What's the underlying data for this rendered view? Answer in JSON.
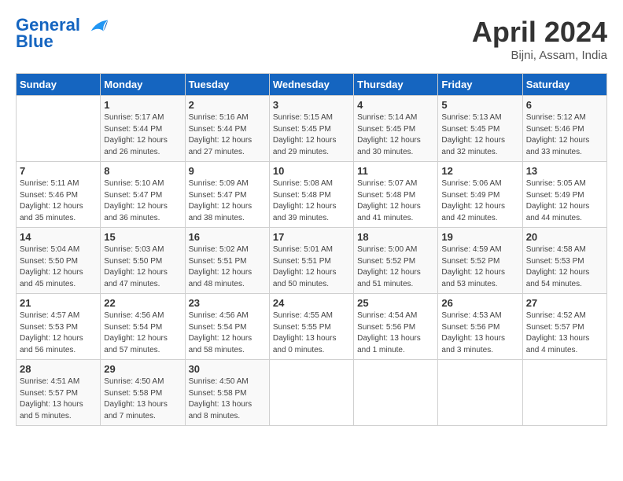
{
  "header": {
    "logo_line1": "General",
    "logo_line2": "Blue",
    "month_title": "April 2024",
    "location": "Bijni, Assam, India"
  },
  "days_header": [
    "Sunday",
    "Monday",
    "Tuesday",
    "Wednesday",
    "Thursday",
    "Friday",
    "Saturday"
  ],
  "weeks": [
    [
      {
        "day": "",
        "info": ""
      },
      {
        "day": "1",
        "info": "Sunrise: 5:17 AM\nSunset: 5:44 PM\nDaylight: 12 hours\nand 26 minutes."
      },
      {
        "day": "2",
        "info": "Sunrise: 5:16 AM\nSunset: 5:44 PM\nDaylight: 12 hours\nand 27 minutes."
      },
      {
        "day": "3",
        "info": "Sunrise: 5:15 AM\nSunset: 5:45 PM\nDaylight: 12 hours\nand 29 minutes."
      },
      {
        "day": "4",
        "info": "Sunrise: 5:14 AM\nSunset: 5:45 PM\nDaylight: 12 hours\nand 30 minutes."
      },
      {
        "day": "5",
        "info": "Sunrise: 5:13 AM\nSunset: 5:45 PM\nDaylight: 12 hours\nand 32 minutes."
      },
      {
        "day": "6",
        "info": "Sunrise: 5:12 AM\nSunset: 5:46 PM\nDaylight: 12 hours\nand 33 minutes."
      }
    ],
    [
      {
        "day": "7",
        "info": "Sunrise: 5:11 AM\nSunset: 5:46 PM\nDaylight: 12 hours\nand 35 minutes."
      },
      {
        "day": "8",
        "info": "Sunrise: 5:10 AM\nSunset: 5:47 PM\nDaylight: 12 hours\nand 36 minutes."
      },
      {
        "day": "9",
        "info": "Sunrise: 5:09 AM\nSunset: 5:47 PM\nDaylight: 12 hours\nand 38 minutes."
      },
      {
        "day": "10",
        "info": "Sunrise: 5:08 AM\nSunset: 5:48 PM\nDaylight: 12 hours\nand 39 minutes."
      },
      {
        "day": "11",
        "info": "Sunrise: 5:07 AM\nSunset: 5:48 PM\nDaylight: 12 hours\nand 41 minutes."
      },
      {
        "day": "12",
        "info": "Sunrise: 5:06 AM\nSunset: 5:49 PM\nDaylight: 12 hours\nand 42 minutes."
      },
      {
        "day": "13",
        "info": "Sunrise: 5:05 AM\nSunset: 5:49 PM\nDaylight: 12 hours\nand 44 minutes."
      }
    ],
    [
      {
        "day": "14",
        "info": "Sunrise: 5:04 AM\nSunset: 5:50 PM\nDaylight: 12 hours\nand 45 minutes."
      },
      {
        "day": "15",
        "info": "Sunrise: 5:03 AM\nSunset: 5:50 PM\nDaylight: 12 hours\nand 47 minutes."
      },
      {
        "day": "16",
        "info": "Sunrise: 5:02 AM\nSunset: 5:51 PM\nDaylight: 12 hours\nand 48 minutes."
      },
      {
        "day": "17",
        "info": "Sunrise: 5:01 AM\nSunset: 5:51 PM\nDaylight: 12 hours\nand 50 minutes."
      },
      {
        "day": "18",
        "info": "Sunrise: 5:00 AM\nSunset: 5:52 PM\nDaylight: 12 hours\nand 51 minutes."
      },
      {
        "day": "19",
        "info": "Sunrise: 4:59 AM\nSunset: 5:52 PM\nDaylight: 12 hours\nand 53 minutes."
      },
      {
        "day": "20",
        "info": "Sunrise: 4:58 AM\nSunset: 5:53 PM\nDaylight: 12 hours\nand 54 minutes."
      }
    ],
    [
      {
        "day": "21",
        "info": "Sunrise: 4:57 AM\nSunset: 5:53 PM\nDaylight: 12 hours\nand 56 minutes."
      },
      {
        "day": "22",
        "info": "Sunrise: 4:56 AM\nSunset: 5:54 PM\nDaylight: 12 hours\nand 57 minutes."
      },
      {
        "day": "23",
        "info": "Sunrise: 4:56 AM\nSunset: 5:54 PM\nDaylight: 12 hours\nand 58 minutes."
      },
      {
        "day": "24",
        "info": "Sunrise: 4:55 AM\nSunset: 5:55 PM\nDaylight: 13 hours\nand 0 minutes."
      },
      {
        "day": "25",
        "info": "Sunrise: 4:54 AM\nSunset: 5:56 PM\nDaylight: 13 hours\nand 1 minute."
      },
      {
        "day": "26",
        "info": "Sunrise: 4:53 AM\nSunset: 5:56 PM\nDaylight: 13 hours\nand 3 minutes."
      },
      {
        "day": "27",
        "info": "Sunrise: 4:52 AM\nSunset: 5:57 PM\nDaylight: 13 hours\nand 4 minutes."
      }
    ],
    [
      {
        "day": "28",
        "info": "Sunrise: 4:51 AM\nSunset: 5:57 PM\nDaylight: 13 hours\nand 5 minutes."
      },
      {
        "day": "29",
        "info": "Sunrise: 4:50 AM\nSunset: 5:58 PM\nDaylight: 13 hours\nand 7 minutes."
      },
      {
        "day": "30",
        "info": "Sunrise: 4:50 AM\nSunset: 5:58 PM\nDaylight: 13 hours\nand 8 minutes."
      },
      {
        "day": "",
        "info": ""
      },
      {
        "day": "",
        "info": ""
      },
      {
        "day": "",
        "info": ""
      },
      {
        "day": "",
        "info": ""
      }
    ]
  ]
}
